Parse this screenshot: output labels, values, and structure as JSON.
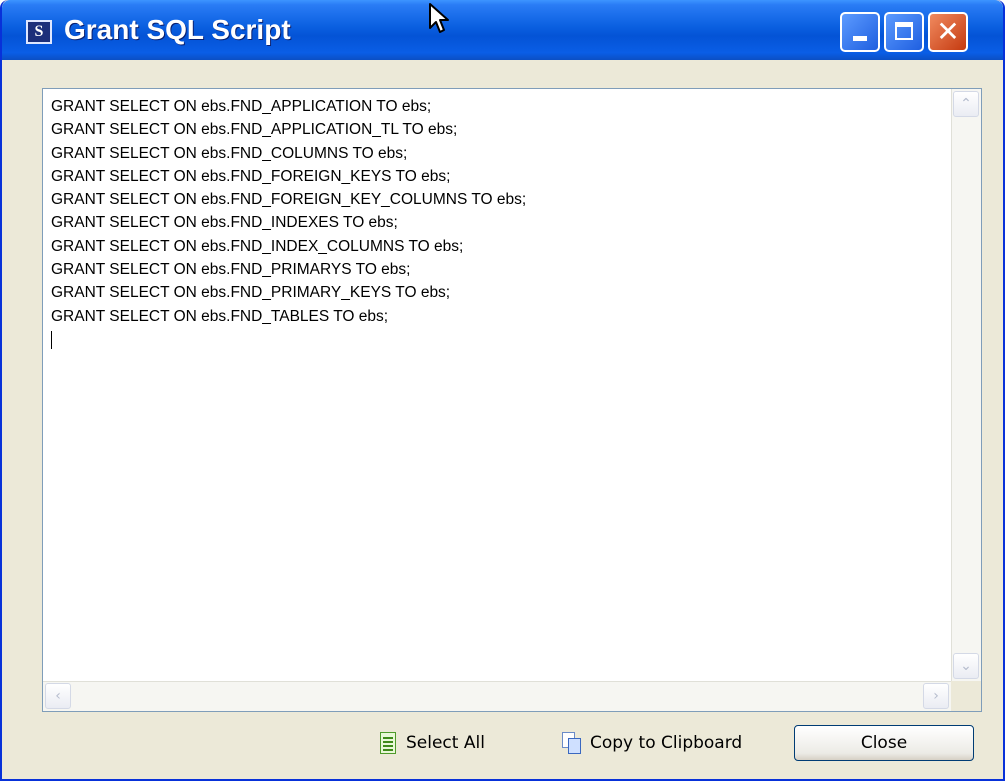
{
  "window": {
    "title": "Grant SQL Script",
    "app_icon_letter": "S"
  },
  "title_buttons": {
    "minimize": "minimize",
    "maximize": "maximize",
    "close_glyph": "✕"
  },
  "script": {
    "lines": [
      "GRANT SELECT ON ebs.FND_APPLICATION TO ebs;",
      "GRANT SELECT ON ebs.FND_APPLICATION_TL TO ebs;",
      "GRANT SELECT ON ebs.FND_COLUMNS TO ebs;",
      "GRANT SELECT ON ebs.FND_FOREIGN_KEYS TO ebs;",
      "GRANT SELECT ON ebs.FND_FOREIGN_KEY_COLUMNS TO ebs;",
      "GRANT SELECT ON ebs.FND_INDEXES TO ebs;",
      "GRANT SELECT ON ebs.FND_INDEX_COLUMNS TO ebs;",
      "GRANT SELECT ON ebs.FND_PRIMARYS TO ebs;",
      "GRANT SELECT ON ebs.FND_PRIMARY_KEYS TO ebs;",
      "GRANT SELECT ON ebs.FND_TABLES TO ebs;"
    ]
  },
  "footer": {
    "select_all_label": "Select All",
    "copy_label": "Copy to Clipboard",
    "close_label": "Close"
  },
  "icons": {
    "app": "sql-app-icon",
    "select_all": "document-icon",
    "copy": "copy-icon",
    "cursor": "mouse-pointer-icon"
  },
  "colors": {
    "titlebar": "#0a5fe0",
    "window_bg": "#ece9d8",
    "close_button": "#c53a10"
  }
}
